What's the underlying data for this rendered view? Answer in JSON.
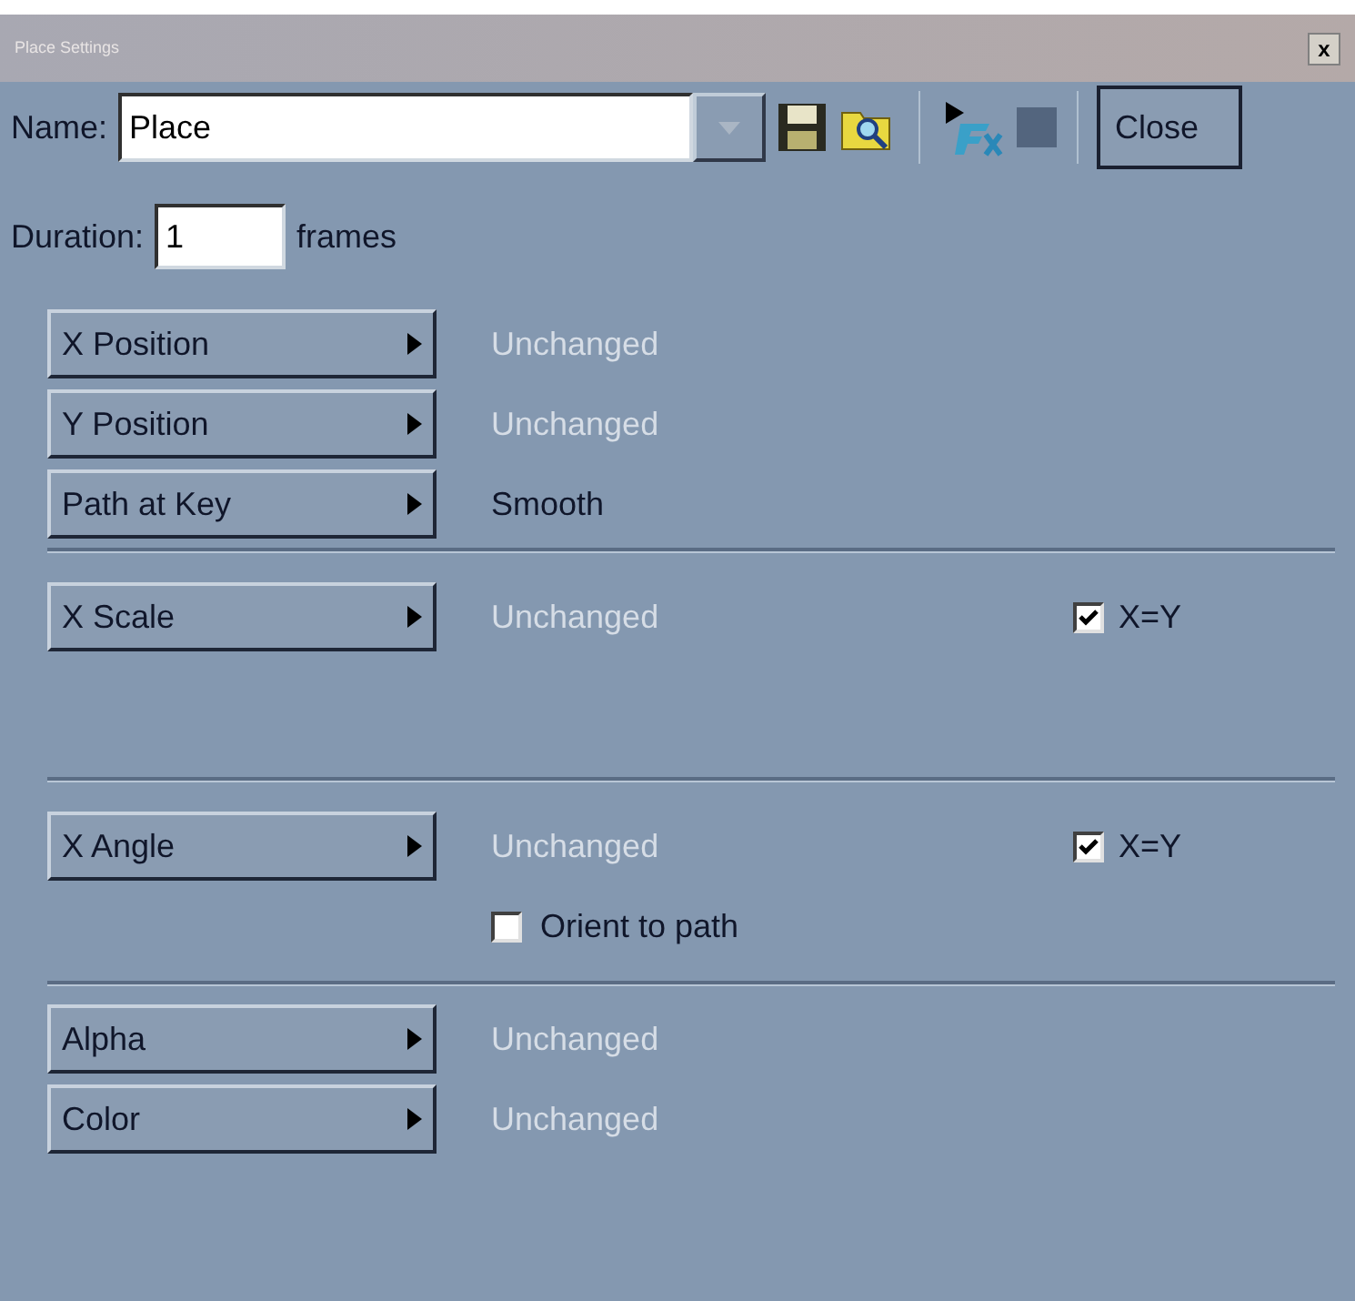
{
  "window": {
    "title": "Place Settings",
    "close": "x"
  },
  "toolbar": {
    "name_label": "Name:",
    "name_value": "Place",
    "close_button": "Close"
  },
  "duration": {
    "label": "Duration:",
    "value": "1",
    "unit": "frames"
  },
  "sections": [
    {
      "rows": [
        {
          "kind": "property",
          "label": "X Position",
          "value": "Unchanged",
          "disabled": true
        },
        {
          "kind": "property",
          "label": "Y Position",
          "value": "Unchanged",
          "disabled": true
        },
        {
          "kind": "property",
          "label": "Path at Key",
          "value": "Smooth",
          "disabled": false
        }
      ]
    },
    {
      "rows": [
        {
          "kind": "property",
          "label": "X Scale",
          "value": "Unchanged",
          "disabled": true,
          "link": {
            "label": "X=Y",
            "checked": true
          }
        }
      ]
    },
    {
      "rows": [
        {
          "kind": "property",
          "label": "X Angle",
          "value": "Unchanged",
          "disabled": true,
          "link": {
            "label": "X=Y",
            "checked": true
          }
        },
        {
          "kind": "checkbox",
          "label": "Orient to path",
          "checked": false
        }
      ]
    },
    {
      "rows": [
        {
          "kind": "property",
          "label": "Alpha",
          "value": "Unchanged",
          "disabled": true
        },
        {
          "kind": "property",
          "label": "Color",
          "value": "Unchanged",
          "disabled": true
        }
      ]
    }
  ]
}
